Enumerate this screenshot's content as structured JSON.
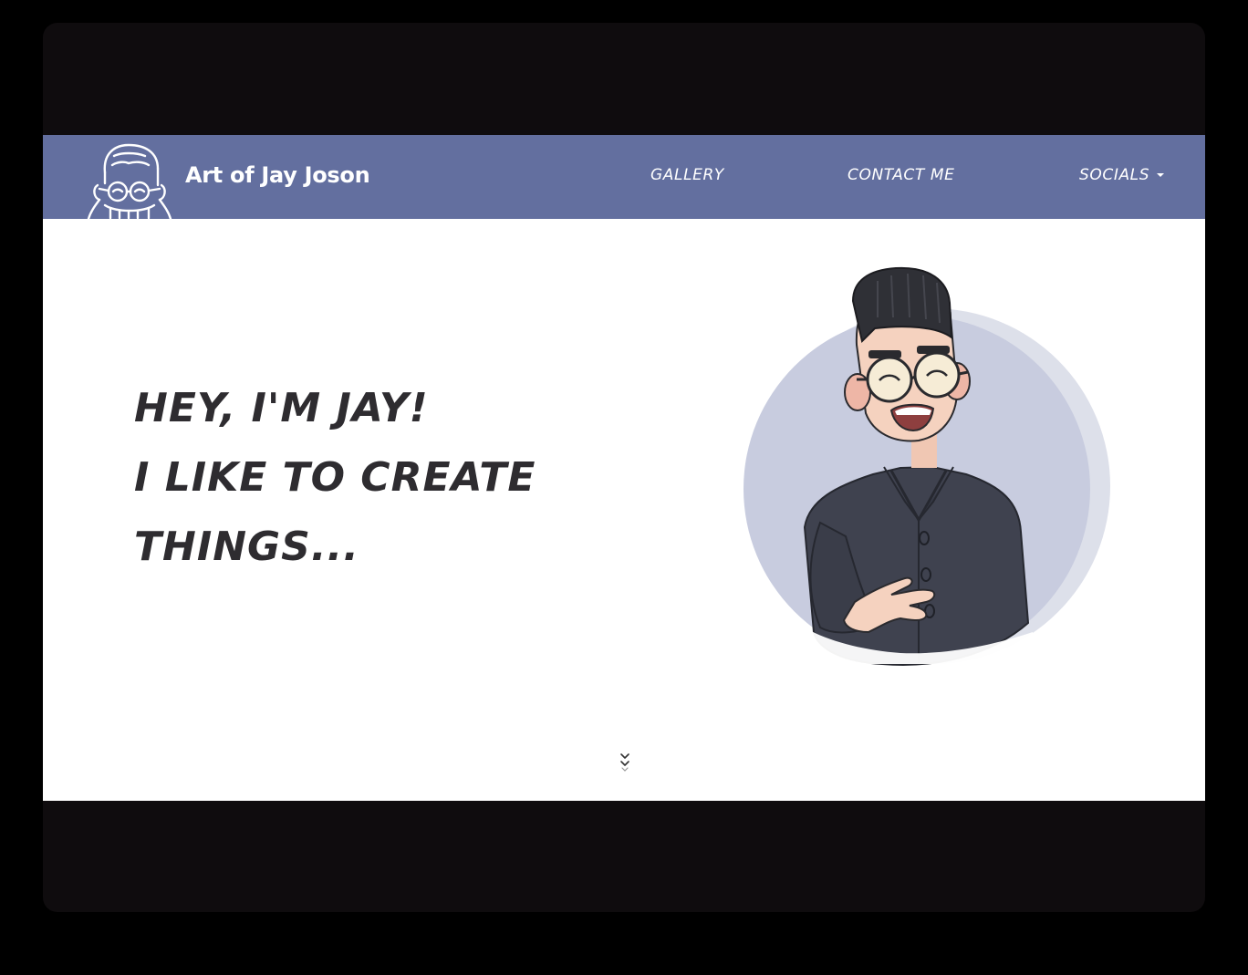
{
  "navbar": {
    "brand": "Art of Jay Joson",
    "links": [
      {
        "label": "GALLERY"
      },
      {
        "label": "CONTACT ME"
      },
      {
        "label": "SOCIALS"
      }
    ],
    "background": "#636f9f"
  },
  "hero": {
    "lines": [
      "HEY, I'M JAY!",
      "I LIKE TO CREATE",
      "THINGS..."
    ],
    "text_color": "#2e2c30",
    "circle_color": "#c8ccdf",
    "shirt_color": "#3f424f"
  },
  "icons": {
    "logo": "jay-avatar-outline-icon",
    "dropdown": "caret-down-icon",
    "scroll": "double-chevron-down-icon"
  }
}
